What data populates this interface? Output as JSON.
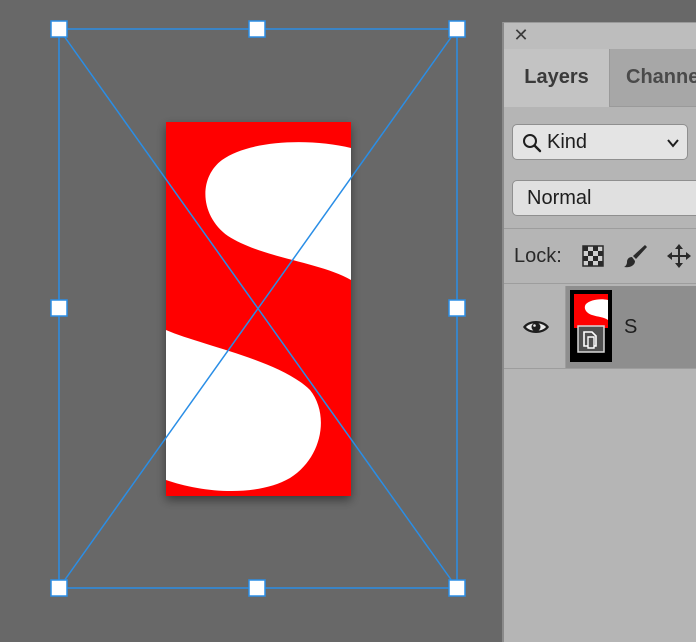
{
  "panel": {
    "close_symbol": "✕",
    "tabs": [
      {
        "label": "Layers"
      },
      {
        "label": "Channe"
      }
    ],
    "filter": {
      "label": "Kind",
      "icon": "search-icon"
    },
    "blend_mode": "Normal",
    "lock": {
      "label": "Lock:",
      "icons": [
        "lock-transparent-pixels-icon",
        "lock-image-pixels-icon",
        "lock-position-icon"
      ]
    },
    "layers": [
      {
        "name": "S",
        "visible": true,
        "smart_object": true
      }
    ]
  },
  "canvas": {
    "image_colors": {
      "background": "#ff0000",
      "glyph": "#ffffff"
    },
    "transform_box_color": "#2a8ee6"
  }
}
